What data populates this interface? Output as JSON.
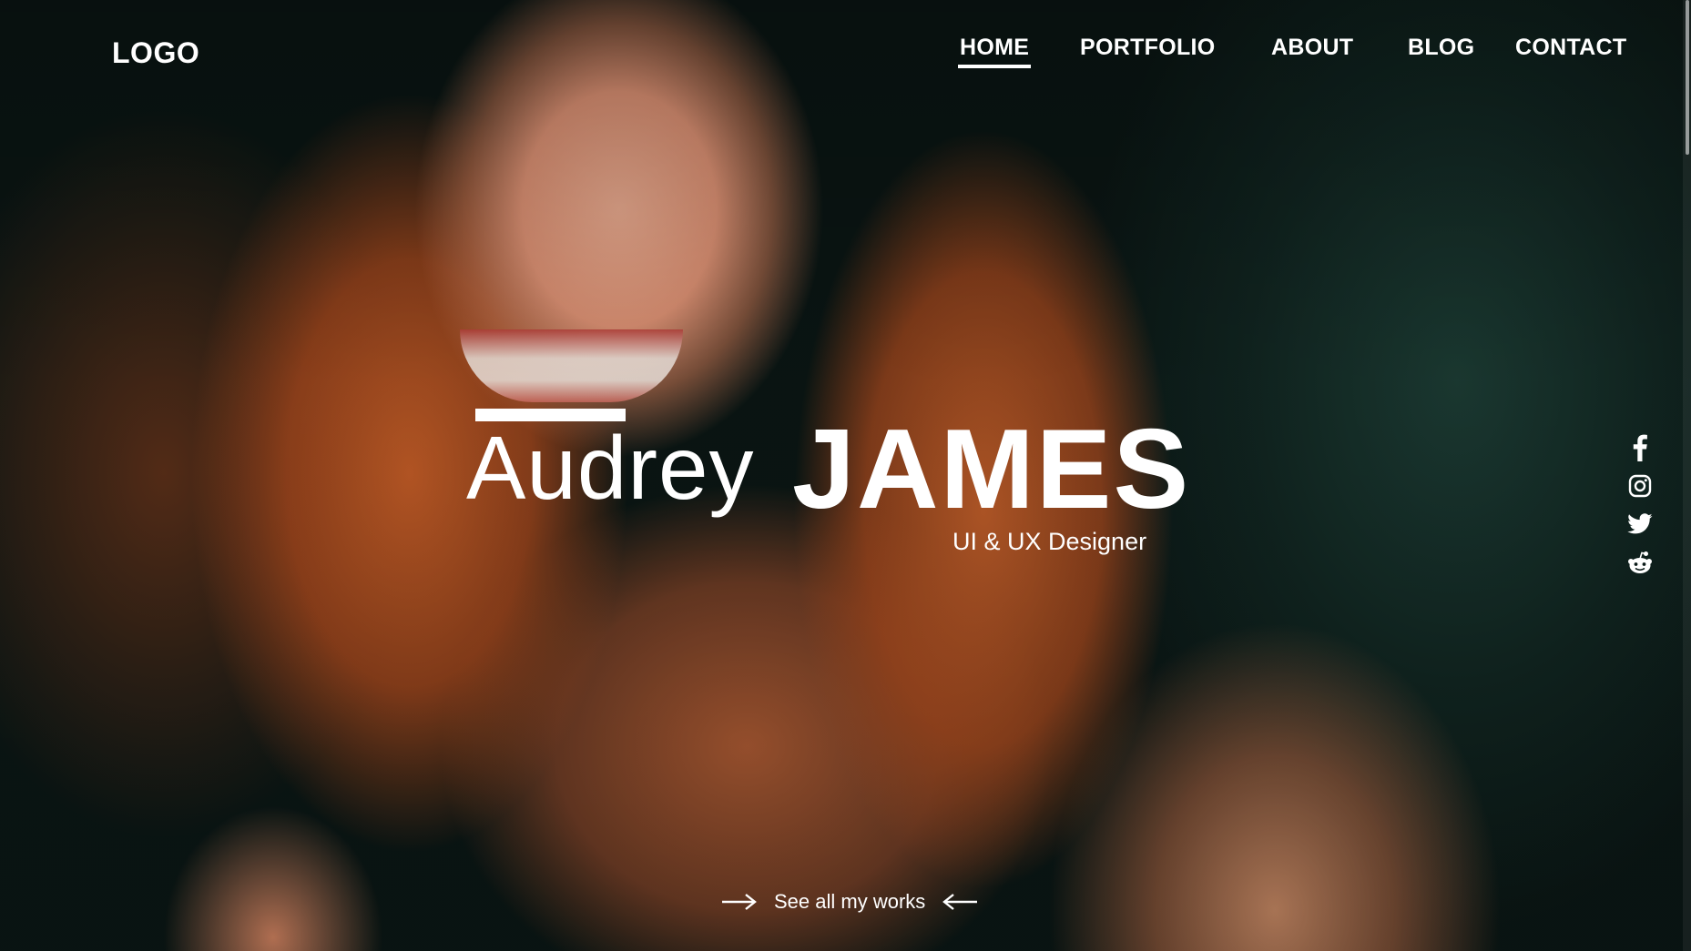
{
  "header": {
    "logo": "LOGO",
    "nav": [
      {
        "label": "HOME",
        "active": true
      },
      {
        "label": "PORTFOLIO",
        "active": false
      },
      {
        "label": "ABOUT",
        "active": false
      },
      {
        "label": "BLOG",
        "active": false
      },
      {
        "label": "CONTACT",
        "active": false
      }
    ]
  },
  "hero": {
    "first_name": "Audrey",
    "last_name": "JAMES",
    "role": "UI & UX Designer",
    "cta_label": "See all my works"
  },
  "social": [
    {
      "icon": "facebook-icon"
    },
    {
      "icon": "instagram-icon"
    },
    {
      "icon": "twitter-icon"
    },
    {
      "icon": "reddit-icon"
    }
  ],
  "colors": {
    "text": "#ffffff",
    "background_dark": "#0b1a18",
    "hair_accent": "#c45c26"
  }
}
